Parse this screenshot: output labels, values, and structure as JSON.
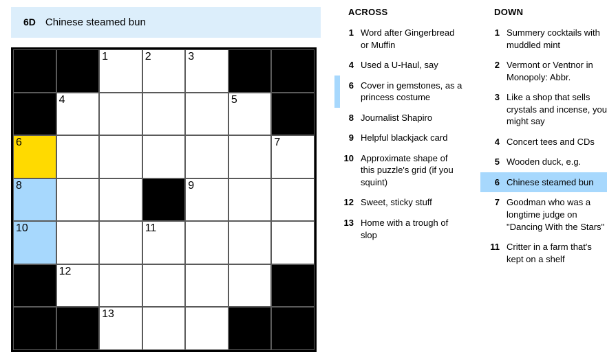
{
  "current_clue": {
    "label": "6D",
    "text": "Chinese steamed bun"
  },
  "grid": {
    "rows": 7,
    "cols": 7,
    "cells": [
      [
        {
          "b": 1
        },
        {
          "b": 1
        },
        {
          "num": "1"
        },
        {
          "num": "2"
        },
        {
          "num": "3"
        },
        {
          "b": 1
        },
        {
          "b": 1
        }
      ],
      [
        {
          "b": 1
        },
        {
          "num": "4"
        },
        {},
        {},
        {},
        {
          "num": "5"
        },
        {
          "b": 1
        }
      ],
      [
        {
          "num": "6",
          "state": "cursor"
        },
        {},
        {},
        {},
        {},
        {},
        {
          "num": "7"
        }
      ],
      [
        {
          "num": "8",
          "state": "hl"
        },
        {},
        {},
        {
          "b": 1
        },
        {
          "num": "9"
        },
        {},
        {}
      ],
      [
        {
          "num": "10",
          "state": "hl"
        },
        {},
        {},
        {
          "num": "11"
        },
        {},
        {},
        {}
      ],
      [
        {
          "b": 1
        },
        {
          "num": "12"
        },
        {},
        {},
        {},
        {},
        {
          "b": 1
        }
      ],
      [
        {
          "b": 1
        },
        {
          "b": 1
        },
        {
          "num": "13"
        },
        {},
        {},
        {
          "b": 1
        },
        {
          "b": 1
        }
      ]
    ]
  },
  "across": {
    "title": "ACROSS",
    "clues": [
      {
        "num": "1",
        "text": "Word after Gingerbread or Muffin"
      },
      {
        "num": "4",
        "text": "Used a U-Haul, say"
      },
      {
        "num": "6",
        "text": "Cover in gemstones, as a princess costume",
        "related": true
      },
      {
        "num": "8",
        "text": "Journalist Shapiro"
      },
      {
        "num": "9",
        "text": "Helpful blackjack card"
      },
      {
        "num": "10",
        "text": "Approximate shape of this puzzle's grid (if you squint)"
      },
      {
        "num": "12",
        "text": "Sweet, sticky stuff"
      },
      {
        "num": "13",
        "text": "Home with a trough of slop"
      }
    ]
  },
  "down": {
    "title": "DOWN",
    "clues": [
      {
        "num": "1",
        "text": "Summery cocktails with muddled mint"
      },
      {
        "num": "2",
        "text": "Vermont or Ventnor in Monopoly: Abbr."
      },
      {
        "num": "3",
        "text": "Like a shop that sells crystals and incense, you might say"
      },
      {
        "num": "4",
        "text": "Concert tees and CDs"
      },
      {
        "num": "5",
        "text": "Wooden duck, e.g."
      },
      {
        "num": "6",
        "text": "Chinese steamed bun",
        "selected": true
      },
      {
        "num": "7",
        "text": "Goodman who was a longtime judge on \"Dancing With the Stars\""
      },
      {
        "num": "11",
        "text": "Critter in a farm that's kept on a shelf"
      }
    ]
  }
}
